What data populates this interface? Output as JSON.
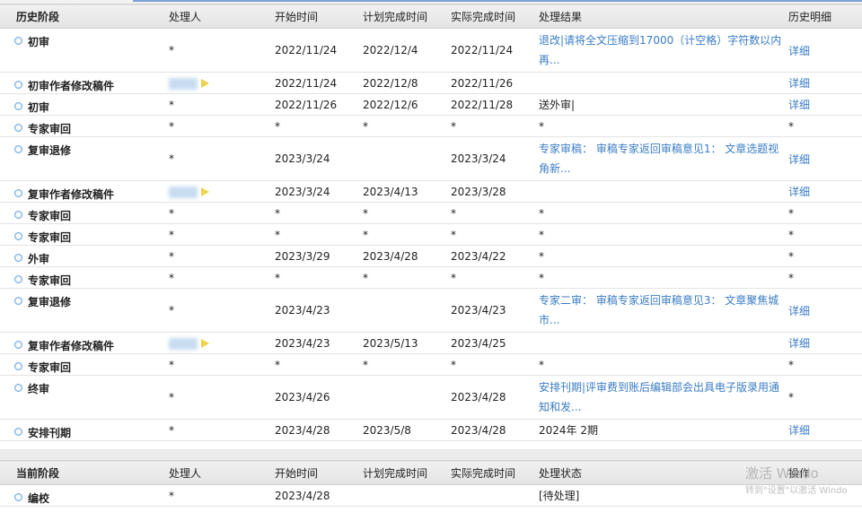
{
  "history": {
    "headers": [
      "历史阶段",
      "处理人",
      "开始时间",
      "计划完成时间",
      "实际完成时间",
      "处理结果",
      "历史明细"
    ],
    "rows": [
      {
        "stage": "初审",
        "handler": "*",
        "start": "2022/11/24",
        "planned": "2022/12/4",
        "actual": "2022/11/24",
        "result": "退改|请将全文压缩到17000（计空格）字符数以内再...",
        "result_link": true,
        "detail": "详细",
        "detail_link": true,
        "tall": true,
        "blur": false
      },
      {
        "stage": "初审作者修改稿件",
        "handler": "",
        "start": "2022/11/24",
        "planned": "2022/12/8",
        "actual": "2022/11/26",
        "result": "",
        "result_link": false,
        "detail": "详细",
        "detail_link": true,
        "tall": false,
        "blur": true
      },
      {
        "stage": "初审",
        "handler": "*",
        "start": "2022/11/26",
        "planned": "2022/12/6",
        "actual": "2022/11/28",
        "result": "送外审|",
        "result_link": false,
        "detail": "详细",
        "detail_link": true,
        "tall": false,
        "blur": false
      },
      {
        "stage": "专家审回",
        "handler": "*",
        "start": "*",
        "planned": "*",
        "actual": "*",
        "result": "*",
        "result_link": false,
        "detail": "*",
        "detail_link": false,
        "tall": false,
        "blur": false
      },
      {
        "stage": "复审退修",
        "handler": "*",
        "start": "2023/3/24",
        "planned": "",
        "actual": "2023/3/24",
        "result": "专家审稿： 审稿专家返回审稿意见1： 文章选题视角新...",
        "result_link": true,
        "detail": "详细",
        "detail_link": true,
        "tall": true,
        "blur": false
      },
      {
        "stage": "复审作者修改稿件",
        "handler": "",
        "start": "2023/3/24",
        "planned": "2023/4/13",
        "actual": "2023/3/28",
        "result": "",
        "result_link": false,
        "detail": "详细",
        "detail_link": true,
        "tall": false,
        "blur": true
      },
      {
        "stage": "专家审回",
        "handler": "*",
        "start": "*",
        "planned": "*",
        "actual": "*",
        "result": "*",
        "result_link": false,
        "detail": "*",
        "detail_link": false,
        "tall": false,
        "blur": false
      },
      {
        "stage": "专家审回",
        "handler": "*",
        "start": "*",
        "planned": "*",
        "actual": "*",
        "result": "*",
        "result_link": false,
        "detail": "*",
        "detail_link": false,
        "tall": false,
        "blur": false
      },
      {
        "stage": "外审",
        "handler": "*",
        "start": "2023/3/29",
        "planned": "2023/4/28",
        "actual": "2023/4/22",
        "result": "*",
        "result_link": false,
        "detail": "*",
        "detail_link": false,
        "tall": false,
        "blur": false
      },
      {
        "stage": "专家审回",
        "handler": "*",
        "start": "*",
        "planned": "*",
        "actual": "*",
        "result": "*",
        "result_link": false,
        "detail": "*",
        "detail_link": false,
        "tall": false,
        "blur": false
      },
      {
        "stage": "复审退修",
        "handler": "*",
        "start": "2023/4/23",
        "planned": "",
        "actual": "2023/4/23",
        "result": "专家二审： 审稿专家返回审稿意见3： 文章聚焦城市...",
        "result_link": true,
        "detail": "详细",
        "detail_link": true,
        "tall": true,
        "blur": false
      },
      {
        "stage": "复审作者修改稿件",
        "handler": "",
        "start": "2023/4/23",
        "planned": "2023/5/13",
        "actual": "2023/4/25",
        "result": "",
        "result_link": false,
        "detail": "详细",
        "detail_link": true,
        "tall": false,
        "blur": true
      },
      {
        "stage": "专家审回",
        "handler": "*",
        "start": "*",
        "planned": "*",
        "actual": "*",
        "result": "*",
        "result_link": false,
        "detail": "*",
        "detail_link": false,
        "tall": false,
        "blur": false
      },
      {
        "stage": "终审",
        "handler": "*",
        "start": "2023/4/26",
        "planned": "",
        "actual": "2023/4/28",
        "result": "安排刊期|评审费到账后编辑部会出具电子版录用通知和发...",
        "result_link": true,
        "detail": "*",
        "detail_link": false,
        "tall": true,
        "blur": false
      },
      {
        "stage": "安排刊期",
        "handler": "*",
        "start": "2023/4/28",
        "planned": "2023/5/8",
        "actual": "2023/4/28",
        "result": "2024年 2期",
        "result_link": false,
        "detail": "详细",
        "detail_link": true,
        "tall": false,
        "blur": false
      }
    ]
  },
  "current": {
    "headers": [
      "当前阶段",
      "处理人",
      "开始时间",
      "计划完成时间",
      "实际完成时间",
      "处理状态",
      "操作"
    ],
    "rows": [
      {
        "stage": "编校",
        "handler": "*",
        "start": "2023/4/28",
        "planned": "",
        "actual": "",
        "status": "[待处理]",
        "op": ""
      }
    ]
  },
  "watermark": {
    "line1": "激活 Windo",
    "line2": "转到\"设置\"以激活 Windo"
  }
}
